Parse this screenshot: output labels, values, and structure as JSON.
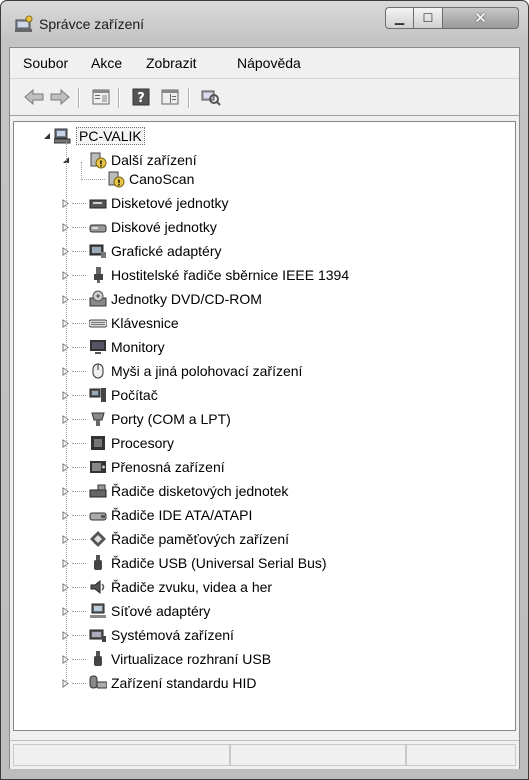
{
  "window": {
    "title": "Správce zařízení"
  },
  "caption": {
    "minimize": "▁",
    "maximize": "☐",
    "close": "✕"
  },
  "menu": [
    "Soubor",
    "Akce",
    "Zobrazit",
    "Nápověda"
  ],
  "toolbar": {
    "icons": [
      "back-arrow-icon",
      "forward-arrow-icon",
      "properties-icon",
      "help-icon",
      "show-hide-tree-icon",
      "scan-hardware-icon"
    ]
  },
  "tree": {
    "root": "PC-VALIK",
    "other_devices": {
      "label": "Další zařízení",
      "children": [
        "CanoScan"
      ]
    },
    "categories": [
      {
        "label": "Disketové jednotky",
        "icon": "floppy-drive-icon"
      },
      {
        "label": "Diskové jednotky",
        "icon": "disk-drive-icon"
      },
      {
        "label": "Grafické adaptéry",
        "icon": "display-adapter-icon"
      },
      {
        "label": "Hostitelské řadiče sběrnice IEEE 1394",
        "icon": "ieee1394-icon"
      },
      {
        "label": "Jednotky DVD/CD-ROM",
        "icon": "dvd-drive-icon"
      },
      {
        "label": "Klávesnice",
        "icon": "keyboard-icon"
      },
      {
        "label": "Monitory",
        "icon": "monitor-icon"
      },
      {
        "label": "Myši a jiná polohovací zařízení",
        "icon": "mouse-icon"
      },
      {
        "label": "Počítač",
        "icon": "computer-icon"
      },
      {
        "label": "Porty (COM a LPT)",
        "icon": "port-icon"
      },
      {
        "label": "Procesory",
        "icon": "processor-icon"
      },
      {
        "label": "Přenosná zařízení",
        "icon": "portable-device-icon"
      },
      {
        "label": "Řadiče disketových jednotek",
        "icon": "floppy-controller-icon"
      },
      {
        "label": "Řadiče IDE ATA/ATAPI",
        "icon": "ide-controller-icon"
      },
      {
        "label": "Řadiče paměťových zařízení",
        "icon": "storage-controller-icon"
      },
      {
        "label": "Řadiče USB (Universal Serial Bus)",
        "icon": "usb-controller-icon"
      },
      {
        "label": "Řadiče zvuku, videa a her",
        "icon": "sound-icon"
      },
      {
        "label": "Síťové adaptéry",
        "icon": "network-adapter-icon"
      },
      {
        "label": "Systémová zařízení",
        "icon": "system-device-icon"
      },
      {
        "label": "Virtualizace rozhraní USB",
        "icon": "usb-virtualization-icon"
      },
      {
        "label": "Zařízení standardu HID",
        "icon": "hid-icon"
      }
    ]
  }
}
